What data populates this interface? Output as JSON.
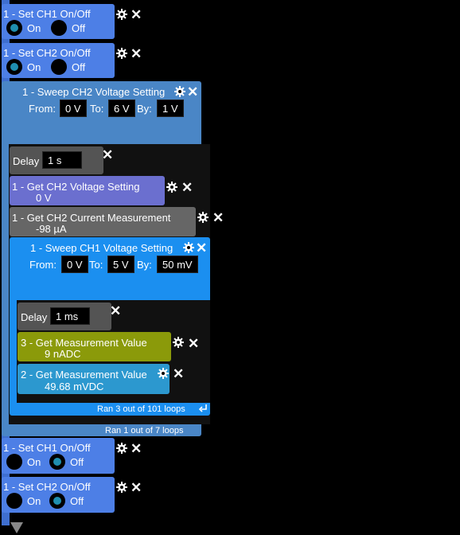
{
  "blocks": {
    "set_ch1_top": {
      "title": "1 - Set CH1 On/Off",
      "on": "On",
      "off": "Off"
    },
    "set_ch2_top": {
      "title": "1 - Set CH2 On/Off",
      "on": "On",
      "off": "Off"
    },
    "sweep_ch2": {
      "title": "1 - Sweep CH2 Voltage Setting",
      "from_label": "From:",
      "from": "0 V",
      "to_label": "To:",
      "to": "6 V",
      "by_label": "By:",
      "by": "1 V",
      "status": "Ran 1 out of 7 loops"
    },
    "delay_outer": {
      "label": "Delay",
      "value": "1 s"
    },
    "get_ch2_voltage": {
      "title": "1 - Get CH2 Voltage Setting",
      "value": "0 V"
    },
    "get_ch2_current": {
      "title": "1 - Get CH2 Current Measurement",
      "value": "-98 µA"
    },
    "sweep_ch1": {
      "title": "1 - Sweep CH1 Voltage Setting",
      "from_label": "From:",
      "from": "0 V",
      "to_label": "To:",
      "to": "5 V",
      "by_label": "By:",
      "by": "50 mV",
      "status": "Ran 3 out of 101 loops"
    },
    "delay_inner": {
      "label": "Delay",
      "value": "1 ms"
    },
    "get_meas_3": {
      "title": "3 - Get Measurement Value",
      "value": "9 nADC"
    },
    "get_meas_2": {
      "title": "2 - Get Measurement Value",
      "value": "49.68 mVDC"
    },
    "set_ch1_bottom": {
      "title": "1 - Set CH1 On/Off",
      "on": "On",
      "off": "Off"
    },
    "set_ch2_bottom": {
      "title": "1 - Set CH2 On/Off",
      "on": "On",
      "off": "Off"
    }
  },
  "icons": {
    "gear": "gear-icon",
    "close": "close-icon",
    "loop_return": "loop-return-icon",
    "flow_end": "flow-arrow-icon"
  },
  "colors": {
    "set_block": "#4d7fe6",
    "sweep_outer": "#4a86c6",
    "sweep_inner": "#1b8ff0",
    "delay": "#545454",
    "get_setting": "#6b6fcf",
    "get_current": "#666666",
    "meas_olive": "#8b9a0a",
    "meas_blue": "#2c98cf",
    "radio_selected": "#1f8fb0"
  }
}
